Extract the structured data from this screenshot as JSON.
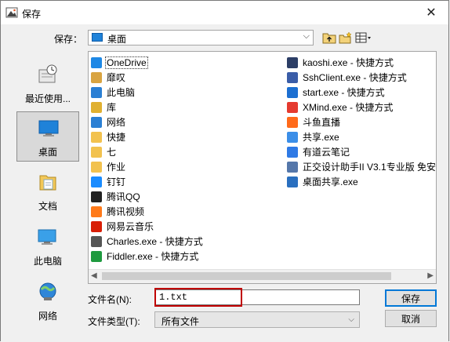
{
  "window": {
    "title": "保存"
  },
  "lookin": {
    "label": "保存：",
    "value": "桌面"
  },
  "places": [
    {
      "label": "最近使用...",
      "icon": "recent-icon"
    },
    {
      "label": "桌面",
      "icon": "desktop-icon",
      "selected": true
    },
    {
      "label": "文档",
      "icon": "documents-icon"
    },
    {
      "label": "此电脑",
      "icon": "computer-icon"
    },
    {
      "label": "网络",
      "icon": "network-icon"
    }
  ],
  "files_col1": [
    {
      "name": "OneDrive",
      "icon": "cloud-icon",
      "color": "#1e88e5",
      "focused": true
    },
    {
      "name": "靡叹",
      "icon": "user-folder-icon",
      "color": "#d9a441"
    },
    {
      "name": "此电脑",
      "icon": "computer-icon",
      "color": "#2a7fd4"
    },
    {
      "name": "库",
      "icon": "library-icon",
      "color": "#e0b030"
    },
    {
      "name": "网络",
      "icon": "network-icon",
      "color": "#2a7fd4"
    },
    {
      "name": "快捷",
      "icon": "folder-icon",
      "color": "#f2c24f"
    },
    {
      "name": "七",
      "icon": "folder-icon",
      "color": "#f2c24f"
    },
    {
      "name": "作业",
      "icon": "folder-icon",
      "color": "#f2c24f"
    },
    {
      "name": "钉钉",
      "icon": "dingtalk-icon",
      "color": "#1a8cff"
    },
    {
      "name": "腾讯QQ",
      "icon": "qq-icon",
      "color": "#222222"
    },
    {
      "name": "腾讯视频",
      "icon": "tencent-video-icon",
      "color": "#ff7a1a"
    },
    {
      "name": "网易云音乐",
      "icon": "netease-music-icon",
      "color": "#d81e06"
    },
    {
      "name": "Charles.exe - 快捷方式",
      "icon": "charles-icon",
      "color": "#555555"
    },
    {
      "name": "Fiddler.exe - 快捷方式",
      "icon": "fiddler-icon",
      "color": "#1f9a3f"
    }
  ],
  "files_col2": [
    {
      "name": "kaoshi.exe - 快捷方式",
      "icon": "app-icon",
      "color": "#2c3e66"
    },
    {
      "name": "SshClient.exe - 快捷方式",
      "icon": "ssh-icon",
      "color": "#3a5da8"
    },
    {
      "name": "start.exe - 快捷方式",
      "icon": "start-icon",
      "color": "#1c6fd1"
    },
    {
      "name": "XMind.exe - 快捷方式",
      "icon": "xmind-icon",
      "color": "#e53a2f"
    },
    {
      "name": "斗鱼直播",
      "icon": "douyu-icon",
      "color": "#ff6a1a"
    },
    {
      "name": "共享.exe",
      "icon": "share-icon",
      "color": "#3b8ee8"
    },
    {
      "name": "有道云笔记",
      "icon": "youdao-icon",
      "color": "#2f7ae5"
    },
    {
      "name": "正交设计助手II V3.1专业版 免安",
      "icon": "app-icon",
      "color": "#5577aa"
    },
    {
      "name": "桌面共享.exe",
      "icon": "desktop-share-icon",
      "color": "#2a6fbf"
    }
  ],
  "filename": {
    "label": "文件名(N):",
    "value": "1.txt"
  },
  "filetype": {
    "label": "文件类型(T):",
    "value": "所有文件"
  },
  "buttons": {
    "save": "保存",
    "cancel": "取消"
  }
}
